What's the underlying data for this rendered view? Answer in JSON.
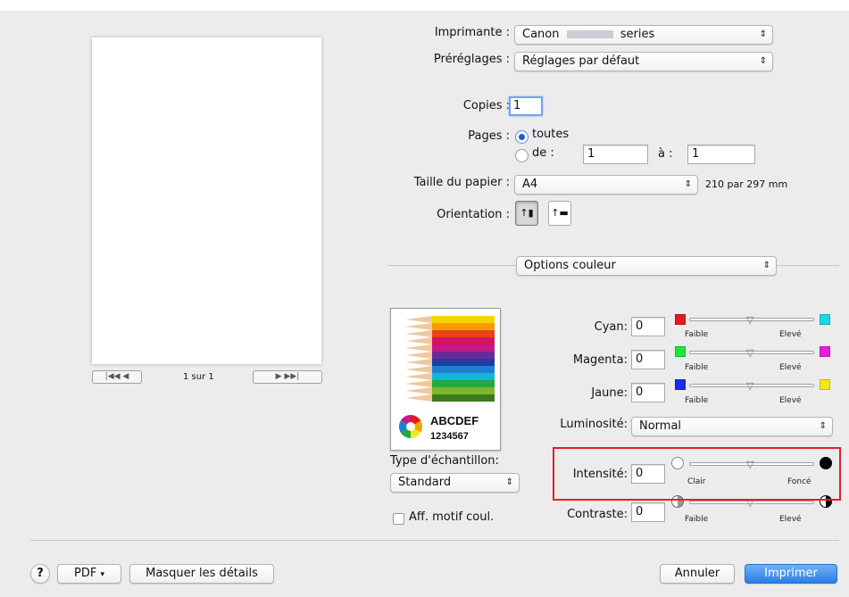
{
  "preview": {
    "page_label": "1 sur 1",
    "nav_first": "|◀◀",
    "nav_prev": "◀",
    "nav_next": "▶",
    "nav_last": "▶▶|"
  },
  "printer": {
    "label": "Imprimante :",
    "value_prefix": "Canon",
    "value_suffix": "series"
  },
  "presets": {
    "label": "Préréglages :",
    "value": "Réglages par défaut"
  },
  "copies": {
    "label": "Copies :",
    "value": "1"
  },
  "pages": {
    "label": "Pages :",
    "option_all": "toutes",
    "option_from": "de :",
    "from_value": "1",
    "to_label": "à :",
    "to_value": "1",
    "selected": "toutes"
  },
  "paper_size": {
    "label": "Taille du papier :",
    "value": "A4",
    "dimensions": "210 par 297 mm"
  },
  "orientation": {
    "label": "Orientation :",
    "selected": "portrait"
  },
  "panel": {
    "value": "Options couleur"
  },
  "sample": {
    "text_line1": "ABCDEF",
    "text_line2": "1234567",
    "type_label": "Type d'échantillon:",
    "type_value": "Standard",
    "show_pattern_label": "Aff. motif coul."
  },
  "color_adjust": {
    "cyan": {
      "label": "Cyan:",
      "value": "0",
      "low": "Faible",
      "high": "Elevé",
      "low_color": "#e8181e",
      "high_color": "#1ad8e8"
    },
    "magenta": {
      "label": "Magenta:",
      "value": "0",
      "low": "Faible",
      "high": "Elevé",
      "low_color": "#1ee83a",
      "high_color": "#e81ed8"
    },
    "yellow": {
      "label": "Jaune:",
      "value": "0",
      "low": "Faible",
      "high": "Elevé",
      "low_color": "#1a2ee8",
      "high_color": "#f2e818"
    },
    "brightness_label": "Luminosité:",
    "brightness_value": "Normal",
    "intensity": {
      "label": "Intensité:",
      "value": "0",
      "low": "Clair",
      "high": "Foncé"
    },
    "contrast": {
      "label": "Contraste:",
      "value": "0",
      "low": "Faible",
      "high": "Elevé"
    }
  },
  "footer": {
    "help": "?",
    "pdf": "PDF",
    "hide_details": "Masquer les détails",
    "cancel": "Annuler",
    "print": "Imprimer"
  },
  "colors": {
    "highlight_border": "#e1202a",
    "default_button": "#2a7ee8"
  }
}
